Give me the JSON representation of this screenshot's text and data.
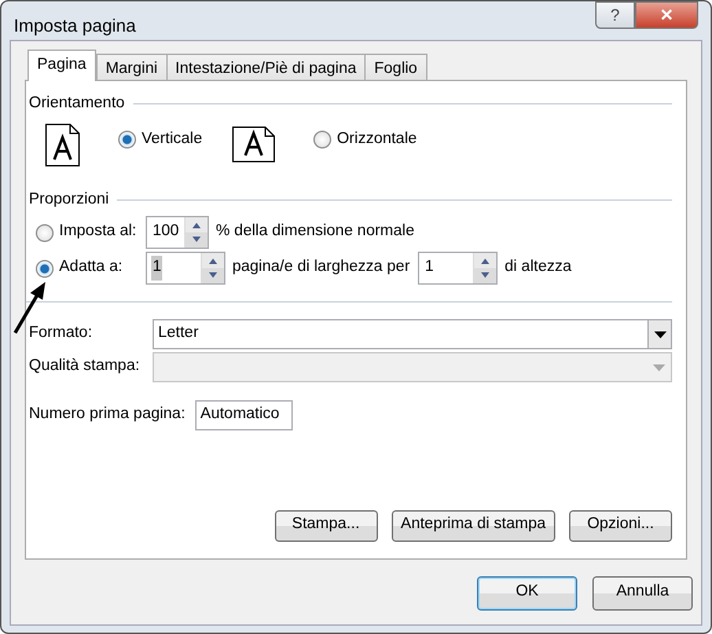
{
  "window": {
    "title": "Imposta pagina",
    "title_buttons": [
      {
        "kind": "help",
        "label": "?"
      },
      {
        "kind": "close",
        "label": "✕"
      }
    ]
  },
  "tabs": [
    {
      "label": "Pagina",
      "selected": true
    },
    {
      "label": "Margini",
      "selected": false
    },
    {
      "label": "Intestazione/Piè di pagina",
      "selected": false
    },
    {
      "label": "Foglio",
      "selected": false
    }
  ],
  "orientation": {
    "title": "Orientamento",
    "options": [
      {
        "label": "Verticale",
        "selected": true,
        "kind": "portrait"
      },
      {
        "label": "Orizzontale",
        "selected": false,
        "kind": "landscape"
      }
    ]
  },
  "scaling": {
    "title": "Proporzioni",
    "rows": [
      {
        "label": "Imposta al:",
        "selected": false,
        "items": [
          {
            "kind": "spin",
            "value": "100",
            "highlighted": false
          },
          {
            "kind": "text",
            "text": "% della dimensione normale"
          }
        ]
      },
      {
        "label": "Adatta a:",
        "selected": true,
        "items": [
          {
            "kind": "spin",
            "value": "1",
            "highlighted": true
          },
          {
            "kind": "text",
            "text": "pagina/e di larghezza per"
          },
          {
            "kind": "spin",
            "value": "1",
            "highlighted": false
          },
          {
            "kind": "text",
            "text": "di altezza"
          }
        ]
      }
    ]
  },
  "paper_size": {
    "label": "Formato:",
    "value": "Letter",
    "disabled": false
  },
  "print_quality": {
    "label": "Qualità stampa:",
    "disabled": true
  },
  "first_page_number": {
    "label": "Numero prima pagina:",
    "value": "Automatico"
  },
  "page_buttons": [
    "Stampa...",
    "Anteprima di stampa",
    "Opzioni..."
  ],
  "dialog_buttons": [
    {
      "label": "OK",
      "default": true
    },
    {
      "label": "Annulla",
      "default": false
    }
  ]
}
